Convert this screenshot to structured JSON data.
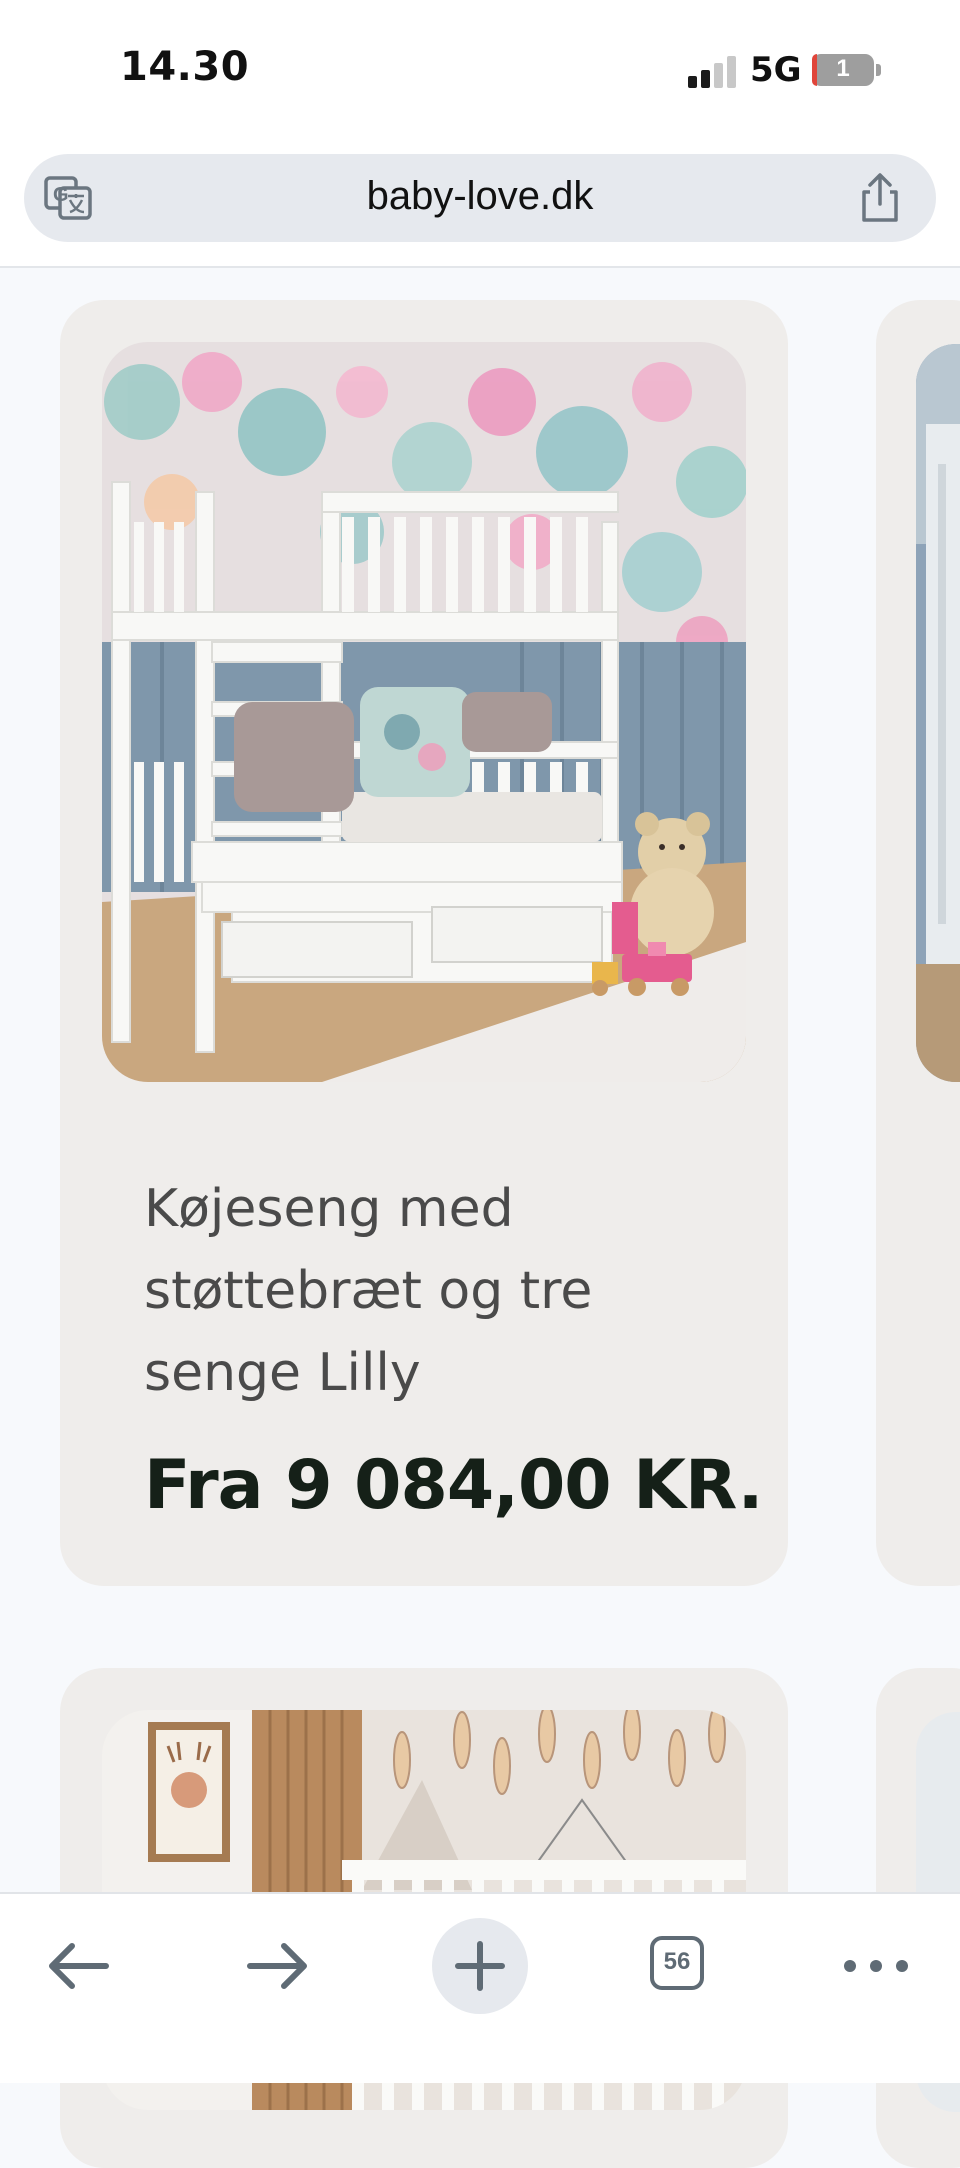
{
  "status_bar": {
    "time": "14.30",
    "network": "5G",
    "battery_level": "1"
  },
  "browser": {
    "url": "baby-love.dk",
    "open_tabs_count": "56"
  },
  "products": [
    {
      "title_lines": [
        "Køjeseng med",
        "støttebræt og tre",
        "senge Lilly"
      ],
      "price": "Fra 9 084,00 KR."
    }
  ],
  "icons": {
    "translate": "translate-icon",
    "share": "share-icon",
    "back": "arrow-left-icon",
    "forward": "arrow-right-icon",
    "new_tab": "plus-icon",
    "tabs": "tabs-icon",
    "more": "more-dots-icon"
  },
  "colors": {
    "page_background": "#f7f9fc",
    "card_background": "#efedeb",
    "price_text": "#152018",
    "battery_low": "#e0453a"
  }
}
